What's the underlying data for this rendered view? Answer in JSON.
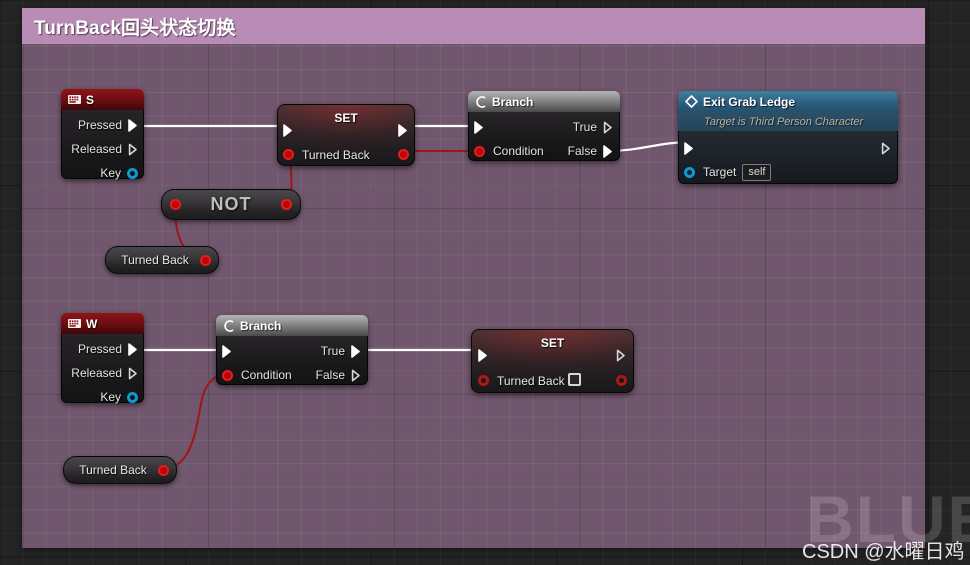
{
  "comment": {
    "title": "TurnBack回头状态切换",
    "color": "#b88cb5"
  },
  "watermark": {
    "big": "BLUEP",
    "small": "CSDN @水曜日鸡"
  },
  "colors": {
    "exec_wire": "#ffffff",
    "bool_wire": "#a01616",
    "bool_pin": "#c00000",
    "object_pin": "#0a9ad6",
    "event_header": "#8f1418",
    "function_header": "#2c5d7c",
    "comment_fill": "#8d6b89"
  },
  "nodes": {
    "event_s": {
      "icon": "keyboard-icon",
      "title": "S",
      "pins": [
        {
          "label": "Pressed",
          "type": "exec",
          "connected": true
        },
        {
          "label": "Released",
          "type": "exec",
          "connected": false
        },
        {
          "label": "Key",
          "type": "object",
          "connected": false
        }
      ]
    },
    "event_w": {
      "icon": "keyboard-icon",
      "title": "W",
      "pins": [
        {
          "label": "Pressed",
          "type": "exec",
          "connected": true
        },
        {
          "label": "Released",
          "type": "exec",
          "connected": false
        },
        {
          "label": "Key",
          "type": "object",
          "connected": false
        }
      ]
    },
    "set_top": {
      "title": "SET",
      "variable": "Turned Back",
      "has_checkbox": false,
      "checkbox_checked": false
    },
    "set_bottom": {
      "title": "SET",
      "variable": "Turned Back",
      "has_checkbox": true,
      "checkbox_checked": false
    },
    "branch_top": {
      "icon": "branch-icon",
      "title": "Branch",
      "condition_label": "Condition",
      "true_label": "True",
      "false_label": "False"
    },
    "branch_bottom": {
      "icon": "branch-icon",
      "title": "Branch",
      "condition_label": "Condition",
      "true_label": "True",
      "false_label": "False"
    },
    "exit_grab_ledge": {
      "icon": "function-diamond-icon",
      "title": "Exit Grab Ledge",
      "subtitle": "Target is Third Person Character",
      "target_label": "Target",
      "target_value": "self"
    },
    "not_node": {
      "title": "NOT"
    },
    "getter_top": {
      "label": "Turned Back"
    },
    "getter_bottom": {
      "label": "Turned Back"
    }
  }
}
